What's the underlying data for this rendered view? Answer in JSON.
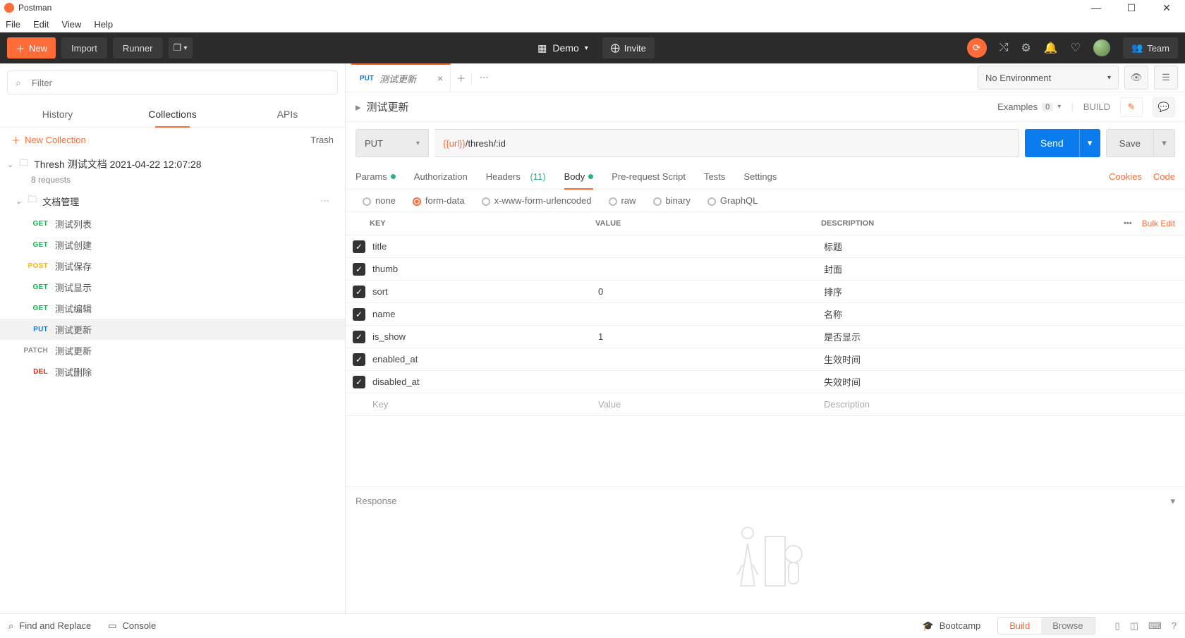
{
  "app": {
    "title": "Postman"
  },
  "menu": {
    "items": [
      "File",
      "Edit",
      "View",
      "Help"
    ]
  },
  "toolbar": {
    "new_label": "New",
    "import_label": "Import",
    "runner_label": "Runner",
    "workspace_name": "Demo",
    "invite_label": "Invite",
    "team_label": "Team"
  },
  "sidebar": {
    "filter_placeholder": "Filter",
    "tabs": {
      "history": "History",
      "collections": "Collections",
      "apis": "APIs"
    },
    "new_collection": "New Collection",
    "trash": "Trash",
    "collection": {
      "name": "Thresh 测试文档 2021-04-22 12:07:28",
      "sub": "8 requests"
    },
    "folder": {
      "name": "文档管理"
    },
    "requests": [
      {
        "method": "GET",
        "name": "测试列表",
        "cls": "m-GET"
      },
      {
        "method": "GET",
        "name": "测试创建",
        "cls": "m-GET"
      },
      {
        "method": "POST",
        "name": "测试保存",
        "cls": "m-POST"
      },
      {
        "method": "GET",
        "name": "测试显示",
        "cls": "m-GET"
      },
      {
        "method": "GET",
        "name": "测试编辑",
        "cls": "m-GET"
      },
      {
        "method": "PUT",
        "name": "测试更新",
        "cls": "m-PUT",
        "active": true
      },
      {
        "method": "PATCH",
        "name": "测试更新",
        "cls": "m-PATCH"
      },
      {
        "method": "DEL",
        "name": "测试删除",
        "cls": "m-DEL"
      }
    ]
  },
  "tab": {
    "method": "PUT",
    "title": "测试更新"
  },
  "env": {
    "label": "No Environment"
  },
  "crumb": {
    "title": "测试更新",
    "examples": "Examples",
    "examples_count": "0",
    "build": "BUILD"
  },
  "request": {
    "method": "PUT",
    "url_var": "{{url}}",
    "url_rest": "/thresh/:id",
    "send": "Send",
    "save": "Save"
  },
  "subtabs": {
    "params": "Params",
    "auth": "Authorization",
    "headers": "Headers",
    "headers_count": "(11)",
    "body": "Body",
    "prereq": "Pre-request Script",
    "tests": "Tests",
    "settings": "Settings",
    "cookies": "Cookies",
    "code": "Code"
  },
  "bodytype": {
    "none": "none",
    "formdata": "form-data",
    "xwww": "x-www-form-urlencoded",
    "raw": "raw",
    "binary": "binary",
    "graphql": "GraphQL"
  },
  "kv": {
    "head_key": "KEY",
    "head_value": "VALUE",
    "head_desc": "DESCRIPTION",
    "bulk": "Bulk Edit",
    "rows": [
      {
        "k": "title",
        "v": "",
        "d": "标题"
      },
      {
        "k": "thumb",
        "v": "",
        "d": "封面"
      },
      {
        "k": "sort",
        "v": "0",
        "d": "排序"
      },
      {
        "k": "name",
        "v": "",
        "d": "名称"
      },
      {
        "k": "is_show",
        "v": "1",
        "d": "是否显示"
      },
      {
        "k": "enabled_at",
        "v": "",
        "d": "生效时间"
      },
      {
        "k": "disabled_at",
        "v": "",
        "d": "失效时间"
      }
    ],
    "ph_key": "Key",
    "ph_val": "Value",
    "ph_desc": "Description"
  },
  "response": {
    "label": "Response"
  },
  "status": {
    "find": "Find and Replace",
    "console": "Console",
    "bootcamp": "Bootcamp",
    "build": "Build",
    "browse": "Browse"
  }
}
